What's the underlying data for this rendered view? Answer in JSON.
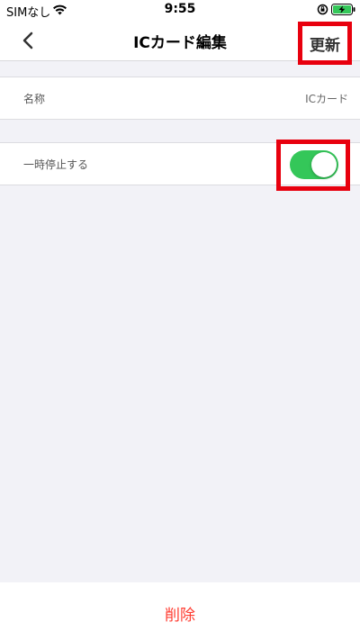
{
  "status_bar": {
    "carrier": "SIMなし",
    "time": "9:55",
    "icons": [
      "wifi-icon",
      "lock-rotation-icon",
      "battery-charging-icon"
    ]
  },
  "nav": {
    "back_icon": "chevron-left-icon",
    "title": "ICカード編集",
    "update_label": "更新",
    "highlight_color": "#e8000e"
  },
  "rows": {
    "name": {
      "label": "名称",
      "value": "ICカード"
    },
    "pause": {
      "label": "一時停止する",
      "toggle_on": true,
      "toggle_color": "#34c759"
    }
  },
  "footer": {
    "delete_label": "削除",
    "delete_color": "#ff3b30"
  }
}
